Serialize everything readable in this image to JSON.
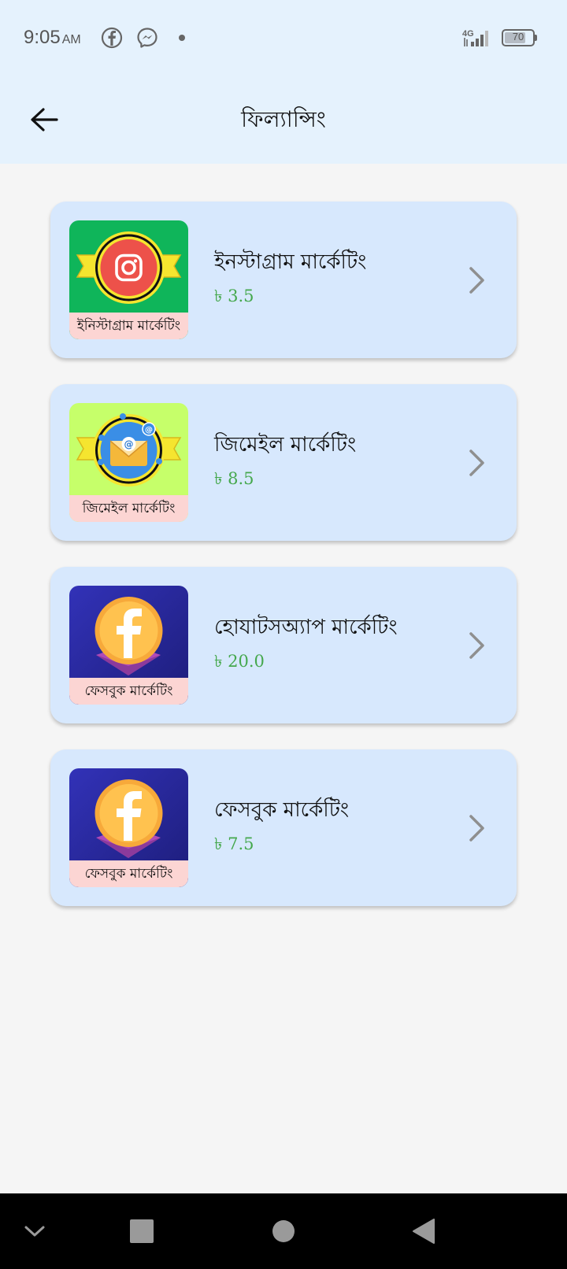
{
  "status_bar": {
    "time": "9:05",
    "ampm": "AM",
    "icons": [
      "facebook-icon",
      "messenger-icon",
      "notification-dot-icon",
      "signal-4g-icon",
      "battery-icon"
    ],
    "network": "4G",
    "battery_level": "70"
  },
  "app_bar": {
    "title": "ফিল্যান্সিং",
    "back_icon": "arrow-left-icon"
  },
  "items": [
    {
      "title": "ইনস্টাগ্রাম মার্কেটিং",
      "price": "৳ 3.5",
      "thumb_label": "ইনিস্টাগ্রাম মার্কেটিং",
      "thumb_icon": "instagram-icon",
      "thumb_bg": "#0fb55a"
    },
    {
      "title": "জিমেইল মার্কেটিং",
      "price": "৳ 8.5",
      "thumb_label": "জিমেইল মার্কেটিং",
      "thumb_icon": "email-icon",
      "thumb_bg": "#c6ff6a"
    },
    {
      "title": "হোযাটসঅ্যাপ মার্কেটিং",
      "price": "৳ 20.0",
      "thumb_label": "ফেসবুক মার্কেটিং",
      "thumb_icon": "facebook-coin-icon",
      "thumb_bg": "#2a2aa6"
    },
    {
      "title": "ফেসবুক মার্কেটিং",
      "price": "৳ 7.5",
      "thumb_label": "ফেসবুক মার্কেটিং",
      "thumb_icon": "facebook-coin-icon",
      "thumb_bg": "#2a2aa6"
    }
  ],
  "colors": {
    "header_bg": "#e5f2fd",
    "card_bg": "#d7e8fd",
    "price": "#45a84d",
    "thumb_label_bg": "#fcd5d3"
  },
  "nav_bar": {
    "buttons": [
      "chevron-down-icon",
      "recent-apps-icon",
      "home-icon",
      "back-triangle-icon"
    ]
  }
}
